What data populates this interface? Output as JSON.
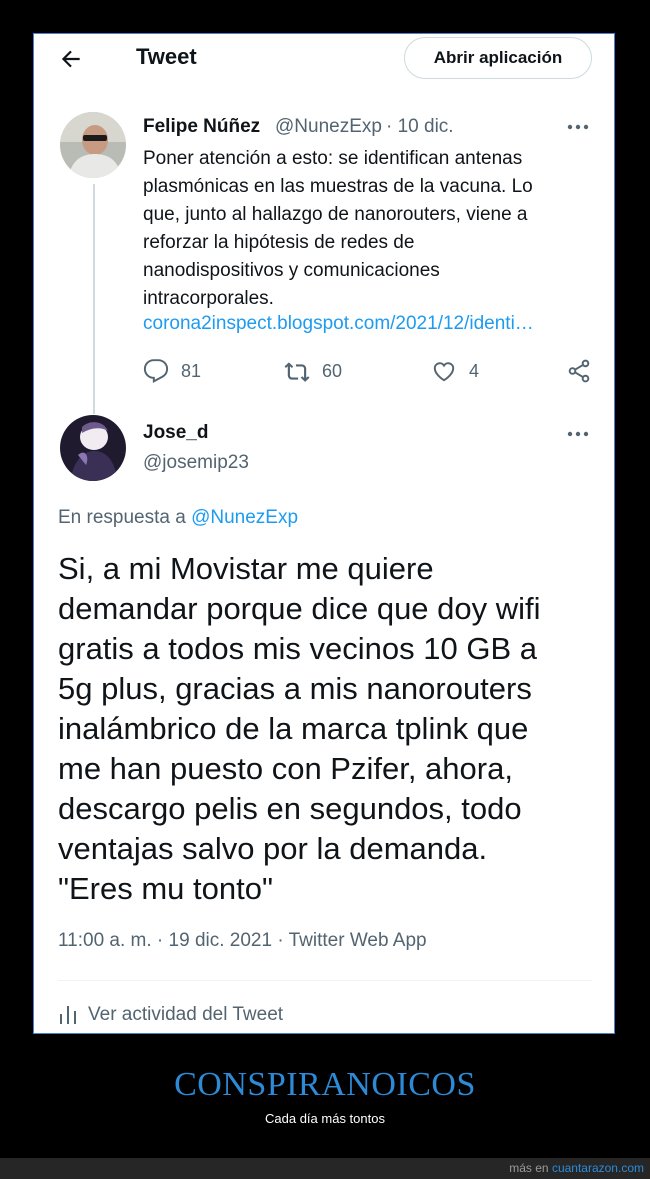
{
  "topbar": {
    "title": "Tweet",
    "open_app_label": "Abrir aplicación"
  },
  "tweet1": {
    "author_name": "Felipe Núñez",
    "author_handle": "@NunezExp",
    "date": "· 10 dic.",
    "text": "Poner atención a esto: se identifican antenas\nplasmónicas en las muestras de la vacuna. Lo\nque, junto al hallazgo de nanorouters, viene a\nreforzar la hipótesis de redes de\nnanodispositivos y comunicaciones\nintracorporales.",
    "link": "corona2inspect.blogspot.com/2021/12/identi…",
    "replies": "81",
    "retweets": "60",
    "likes": "4"
  },
  "tweet2": {
    "author_name": "Jose_d",
    "author_handle": "@josemip23",
    "reply_prefix": "En respuesta a",
    "reply_mention": "@NunezExp",
    "text": "Si, a mi Movistar me quiere\ndemandar porque dice que doy wifi\ngratis a todos mis vecinos 10 GB a\n5g plus, gracias a mis nanorouters\ninalámbrico de la marca tplink que\nme han puesto con Pzifer, ahora,\ndescargo pelis en segundos, todo\nventajas salvo por la demanda.\n\"Eres mu tonto\"",
    "timestamp": "11:00 a. m. · 19 dic. 2021 · Twitter Web App",
    "activity_label": "Ver actividad del Tweet"
  },
  "caption": {
    "title": "CONSPIRANOICOS",
    "subtitle": "Cada día más tontos"
  },
  "footer": {
    "prefix": "más en",
    "site": "cuantarazon.com"
  },
  "colors": {
    "accent": "#1d9bf0",
    "muted": "#536471",
    "text": "#0f1419",
    "caption": "#2d8ad6"
  },
  "icons": [
    "back-arrow-icon",
    "more-icon",
    "reply-icon",
    "retweet-icon",
    "like-icon",
    "share-icon",
    "activity-icon"
  ]
}
